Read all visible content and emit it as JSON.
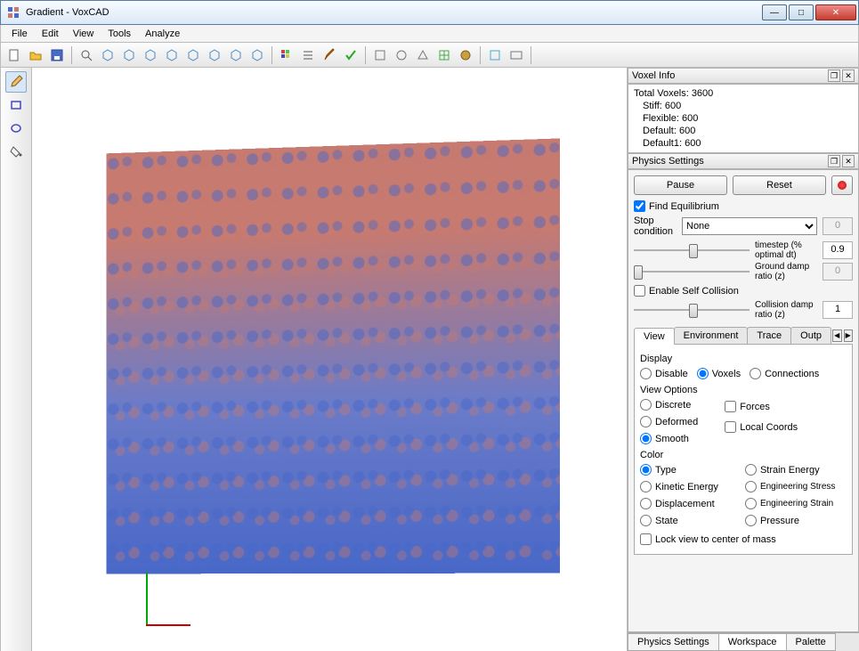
{
  "window": {
    "title": "Gradient - VoxCAD"
  },
  "menu": {
    "file": "File",
    "edit": "Edit",
    "view": "View",
    "tools": "Tools",
    "analyze": "Analyze"
  },
  "voxel_info": {
    "title": "Voxel Info",
    "total": "Total Voxels: 3600",
    "stiff": "Stiff: 600",
    "flexible": "Flexible: 600",
    "default": "Default: 600",
    "default1": "Default1: 600"
  },
  "physics": {
    "title": "Physics Settings",
    "pause": "Pause",
    "reset": "Reset",
    "find_equilibrium": "Find Equilibrium",
    "stop_condition_label": "Stop condition",
    "stop_condition_value": "None",
    "stop_condition_num": "0",
    "timestep_label": "timestep (% optimal dt)",
    "timestep_value": "0.9",
    "ground_damp_label": "Ground damp ratio (z)",
    "ground_damp_value": "0",
    "enable_self_collision": "Enable Self Collision",
    "collision_damp_label": "Collision damp ratio (z)",
    "collision_damp_value": "1"
  },
  "tabs": {
    "view": "View",
    "environment": "Environment",
    "trace": "Trace",
    "output": "Outp"
  },
  "view_tab": {
    "display": "Display",
    "disable": "Disable",
    "voxels": "Voxels",
    "connections": "Connections",
    "view_options": "View Options",
    "discrete": "Discrete",
    "deformed": "Deformed",
    "smooth": "Smooth",
    "forces": "Forces",
    "local_coords": "Local Coords",
    "color": "Color",
    "type": "Type",
    "kinetic_energy": "Kinetic Energy",
    "displacement": "Displacement",
    "state": "State",
    "strain_energy": "Strain Energy",
    "engineering_stress": "Engineering Stress",
    "engineering_strain": "Engineering Strain",
    "pressure": "Pressure",
    "lock_view": "Lock view to center of mass"
  },
  "bottom_tabs": {
    "physics": "Physics Settings",
    "workspace": "Workspace",
    "palette": "Palette"
  }
}
